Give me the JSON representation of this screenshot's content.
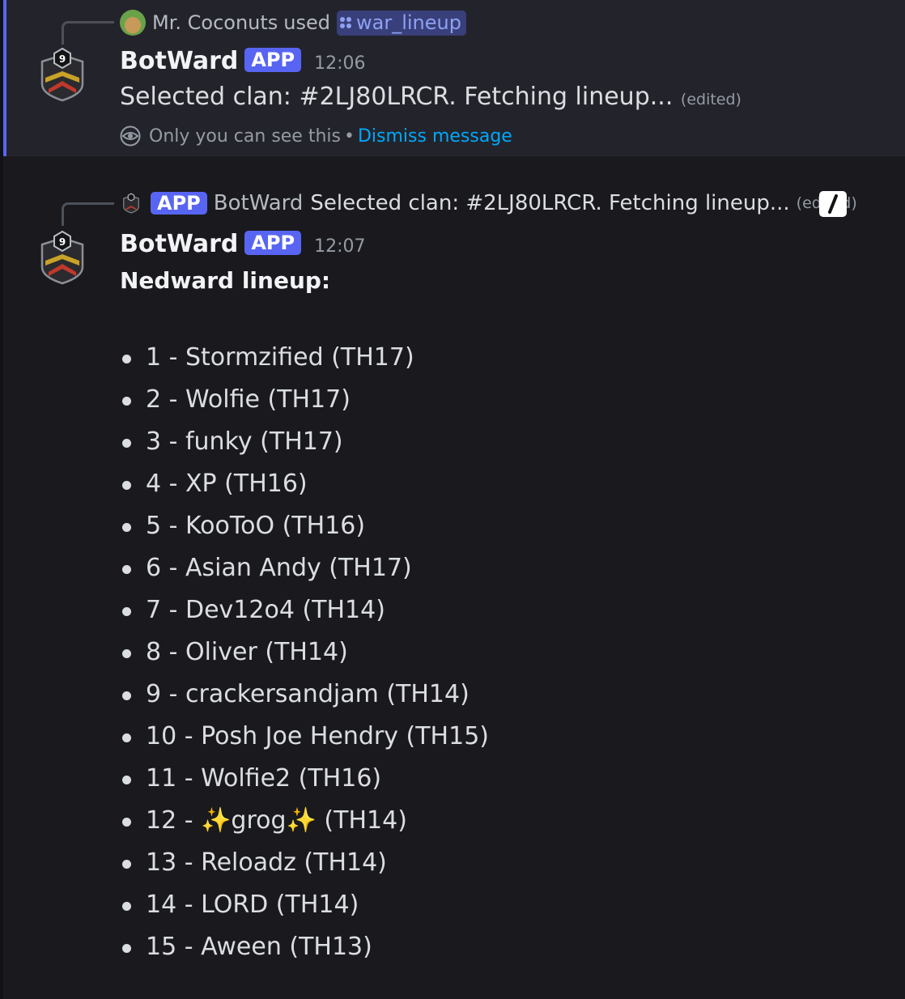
{
  "message1": {
    "reply": {
      "user": "Mr. Coconuts",
      "used_text": "used",
      "command": "war_lineup"
    },
    "author": "BotWard",
    "badge": "APP",
    "time": "12:06",
    "content": "Selected clan: #2LJ80LRCR. Fetching lineup...",
    "edited": "(edited)",
    "ephemeral_note": "Only you can see this",
    "separator": "•",
    "dismiss": "Dismiss message",
    "avatar_level": "9"
  },
  "message2": {
    "reply": {
      "badge": "APP",
      "author": "BotWard",
      "content": "Selected clan: #2LJ80LRCR. Fetching lineup...",
      "edited": "(edited)"
    },
    "author": "BotWard",
    "badge": "APP",
    "time": "12:07",
    "title": "Nedward lineup:",
    "avatar_level": "9",
    "lineup": [
      "1 - Stormzified (TH17)",
      "2 - Wolfie (TH17)",
      "3 - funky (TH17)",
      "4 - XP (TH16)",
      "5 - KooToO (TH16)",
      "6 - Asian Andy (TH17)",
      "7 - Dev12o4 (TH14)",
      "8 - Oliver (TH14)",
      "9 - crackersandjam (TH14)",
      "10 - Posh Joe Hendry (TH15)",
      "11 - Wolfie2 (TH16)",
      "12 - ✨grog✨ (TH14)",
      "13 - Reloadz (TH14)",
      "14 - LORD (TH14)",
      "15 - Aween (TH13)"
    ]
  },
  "colors": {
    "accent": "#5865f2",
    "link": "#00a8fc",
    "background": "#1a1a1e",
    "ephemeral_background": "#23242b"
  },
  "icons": {
    "command_icon": "command-dots-icon",
    "eye_icon": "eye-icon",
    "slash_icon": "slash-command-icon",
    "avatar": "botward-crest-icon"
  }
}
